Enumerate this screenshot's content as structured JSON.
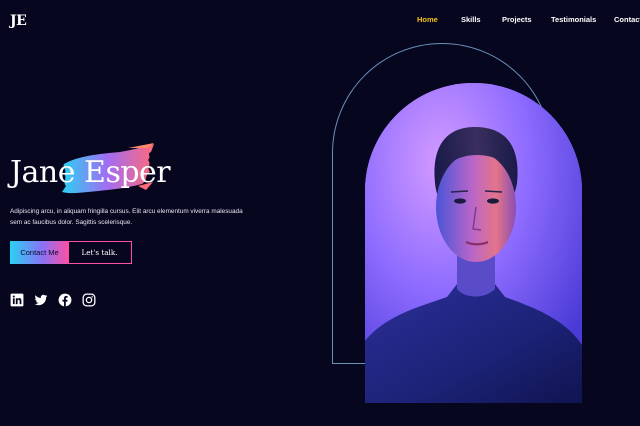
{
  "logo": "JE",
  "nav": {
    "items": [
      {
        "label": "Home",
        "active": true
      },
      {
        "label": "Skills",
        "active": false
      },
      {
        "label": "Projects",
        "active": false
      },
      {
        "label": "Testimonials",
        "active": false
      },
      {
        "label": "Contact",
        "active": false
      }
    ]
  },
  "hero": {
    "first_name": "Jane",
    "last_name": "Esper",
    "description": "Adipiscing arcu, in aliquam fringilla cursus. Elit arcu elementum viverra malesuada sem ac faucibus dolor. Sagittis scelerisque.",
    "primary_button": "Contact Me",
    "secondary_button": "Let's talk."
  },
  "socials": [
    "linkedin-icon",
    "twitter-icon",
    "facebook-icon",
    "instagram-icon"
  ],
  "colors": {
    "background": "#07061f",
    "accent_active": "#f4c21b",
    "gradient_start": "#2ad1f4",
    "gradient_end": "#ff4fa3",
    "arch_outline": "#6a8fb8"
  }
}
